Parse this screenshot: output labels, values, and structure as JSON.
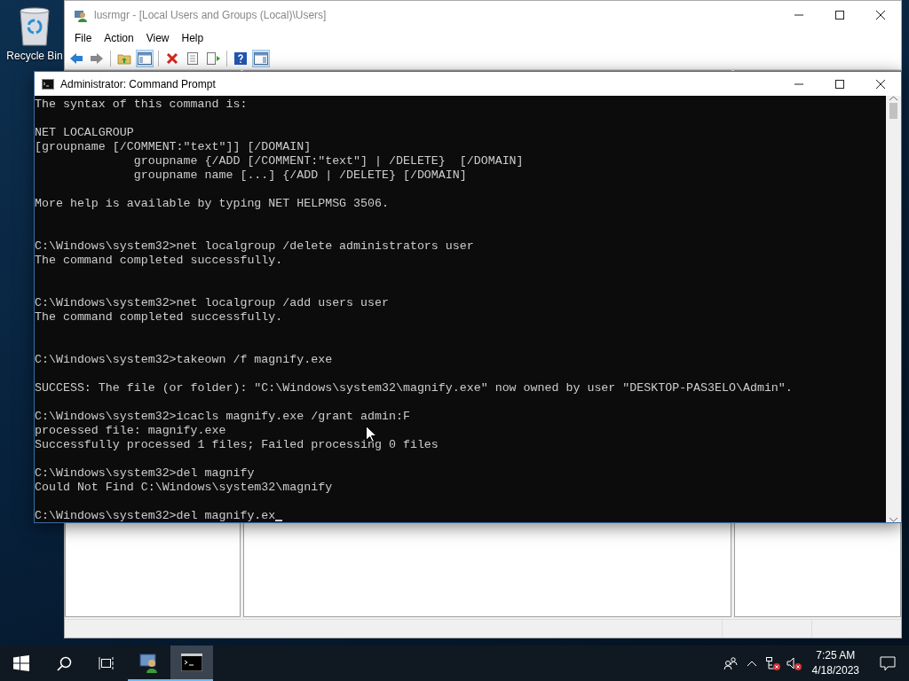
{
  "desktop": {
    "icons": [
      {
        "label": "Recycle Bin"
      }
    ]
  },
  "background_window": {
    "title": "lusrmgr - [Local Users and Groups (Local)\\Users]",
    "menu": [
      "File",
      "Action",
      "View",
      "Help"
    ]
  },
  "console_window": {
    "title": "Administrator: Command Prompt",
    "cursor": true,
    "lines": [
      {
        "kind": "text",
        "text": "The syntax of this command is:"
      },
      {
        "kind": "blank"
      },
      {
        "kind": "text",
        "text": "NET LOCALGROUP"
      },
      {
        "kind": "text",
        "text": "[groupname [/COMMENT:\"text\"]] [/DOMAIN]"
      },
      {
        "kind": "text",
        "text": "              groupname {/ADD [/COMMENT:\"text\"] | /DELETE}  [/DOMAIN]"
      },
      {
        "kind": "text",
        "text": "              groupname name [...] {/ADD | /DELETE} [/DOMAIN]"
      },
      {
        "kind": "blank"
      },
      {
        "kind": "text",
        "text": "More help is available by typing NET HELPMSG 3506."
      },
      {
        "kind": "blank"
      },
      {
        "kind": "blank"
      },
      {
        "kind": "text",
        "text": "C:\\Windows\\system32>net localgroup /delete administrators user"
      },
      {
        "kind": "text",
        "text": "The command completed successfully."
      },
      {
        "kind": "blank"
      },
      {
        "kind": "blank"
      },
      {
        "kind": "text",
        "text": "C:\\Windows\\system32>net localgroup /add users user"
      },
      {
        "kind": "text",
        "text": "The command completed successfully."
      },
      {
        "kind": "blank"
      },
      {
        "kind": "blank"
      },
      {
        "kind": "text",
        "text": "C:\\Windows\\system32>takeown /f magnify.exe"
      },
      {
        "kind": "blank"
      },
      {
        "kind": "text",
        "text": "SUCCESS: The file (or folder): \"C:\\Windows\\system32\\magnify.exe\" now owned by user \"DESKTOP-PAS3ELO\\Admin\"."
      },
      {
        "kind": "blank"
      },
      {
        "kind": "text",
        "text": "C:\\Windows\\system32>icacls magnify.exe /grant admin:F"
      },
      {
        "kind": "text",
        "text": "processed file: magnify.exe"
      },
      {
        "kind": "text",
        "text": "Successfully processed 1 files; Failed processing 0 files"
      },
      {
        "kind": "blank"
      },
      {
        "kind": "text",
        "text": "C:\\Windows\\system32>del magnify"
      },
      {
        "kind": "text",
        "text": "Could Not Find C:\\Windows\\system32\\magnify"
      },
      {
        "kind": "blank"
      },
      {
        "kind": "prompt",
        "text": "C:\\Windows\\system32>del magnify.ex"
      }
    ]
  },
  "taskbar": {
    "apps": [
      {
        "selected": false
      },
      {
        "selected": true
      }
    ],
    "clock": {
      "time": "7:25 AM",
      "date": "4/18/2023"
    }
  }
}
